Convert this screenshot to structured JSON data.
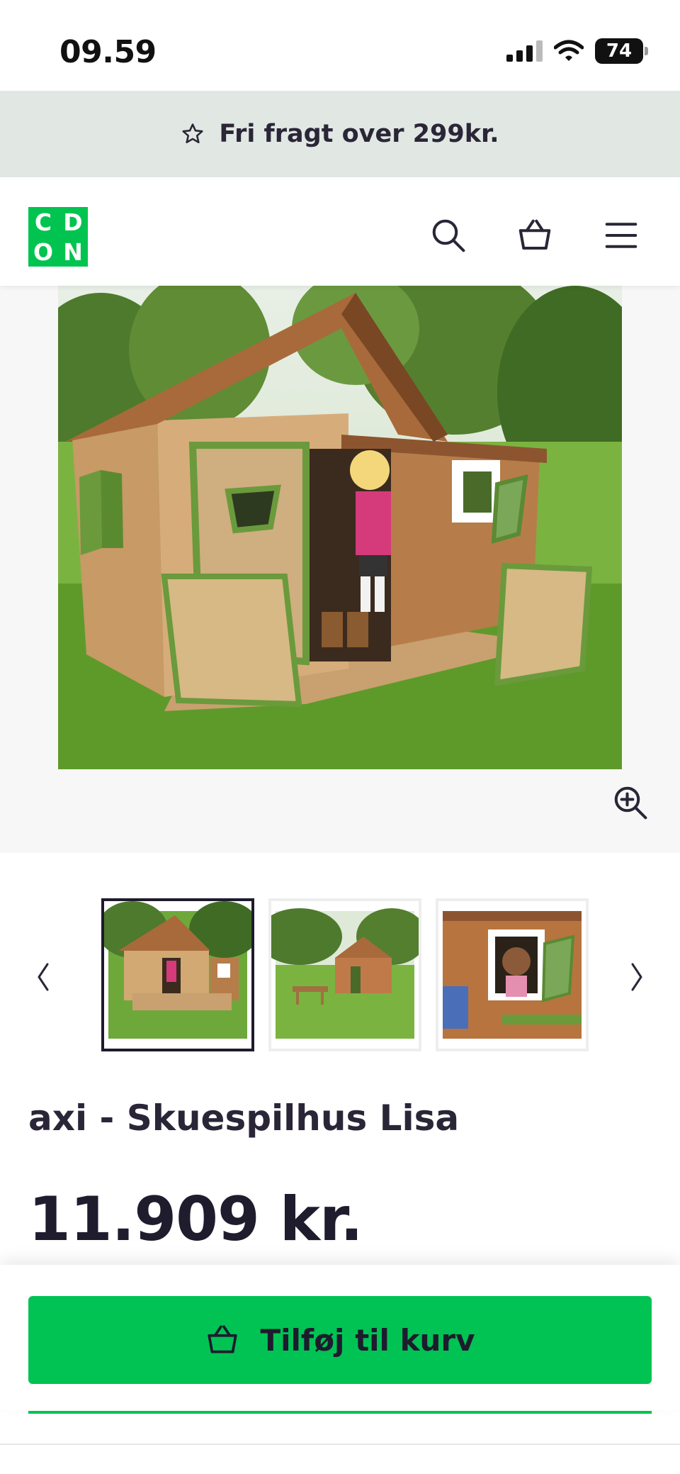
{
  "status_bar": {
    "time": "09.59",
    "battery": "74"
  },
  "promo": {
    "text": "Fri fragt over 299kr.",
    "icon": "star-outline-icon"
  },
  "header": {
    "logo_letters": [
      "C",
      "D",
      "O",
      "N"
    ],
    "brand_color": "#00c44f",
    "icons": [
      "search-icon",
      "basket-icon",
      "hamburger-menu-icon"
    ]
  },
  "gallery": {
    "main_image": "wooden-playhouse-photo",
    "thumbnails": [
      "playhouse-front",
      "playhouse-garden",
      "girl-in-window"
    ],
    "selected_index": 0
  },
  "product": {
    "title": "axi - Skuespilhus Lisa",
    "price": "11.909 kr."
  },
  "cart": {
    "button_label": "Tilføj til kurv",
    "button_color": "#00c353"
  }
}
